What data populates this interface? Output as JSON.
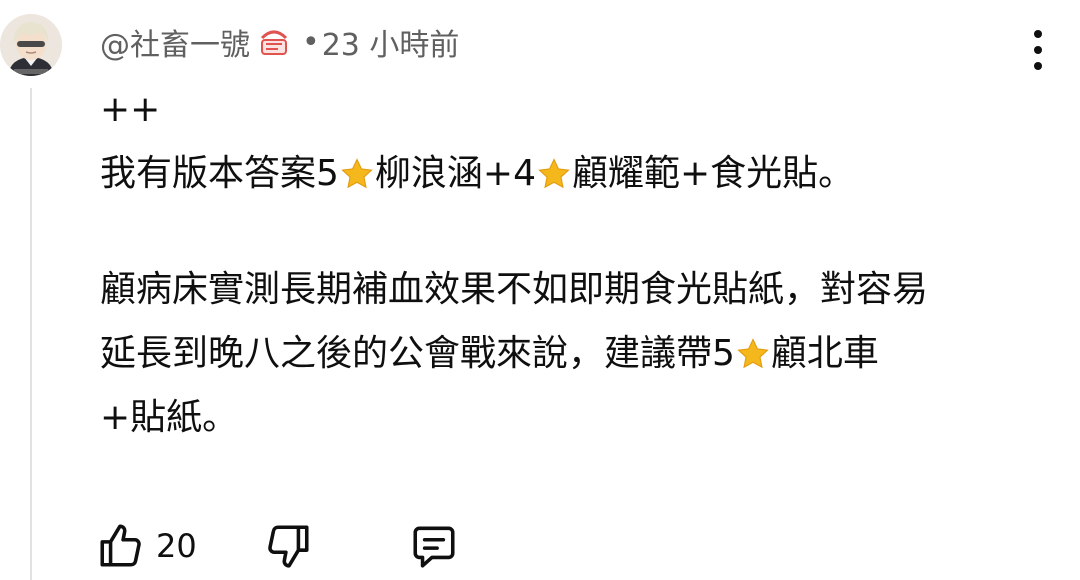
{
  "comment": {
    "author": "@社畜一號",
    "separator": "•",
    "time": "23 小時前",
    "lines": [
      [
        "++"
      ],
      [
        "我有版本答案5",
        "star",
        "柳浪涵+4",
        "star",
        "顧耀範+食光貼。"
      ],
      [
        "顧病床實測長期補血效果不如即期食光貼紙，對容易"
      ],
      [
        "延長到晚八之後的公會戰來說，建議帶5",
        "star",
        "顧北車"
      ],
      [
        "+貼紙。"
      ]
    ],
    "like_count": "20"
  },
  "icons": {
    "badge": "membership-badge-icon",
    "star": "star-emoji-icon",
    "more": "more-vertical-icon",
    "like": "thumbs-up-icon",
    "dislike": "thumbs-down-icon",
    "reply": "reply-comment-icon"
  },
  "colors": {
    "text": "#0f0f0f",
    "meta": "#606060",
    "star": "#f5b81c",
    "badge": "#e0534f"
  }
}
